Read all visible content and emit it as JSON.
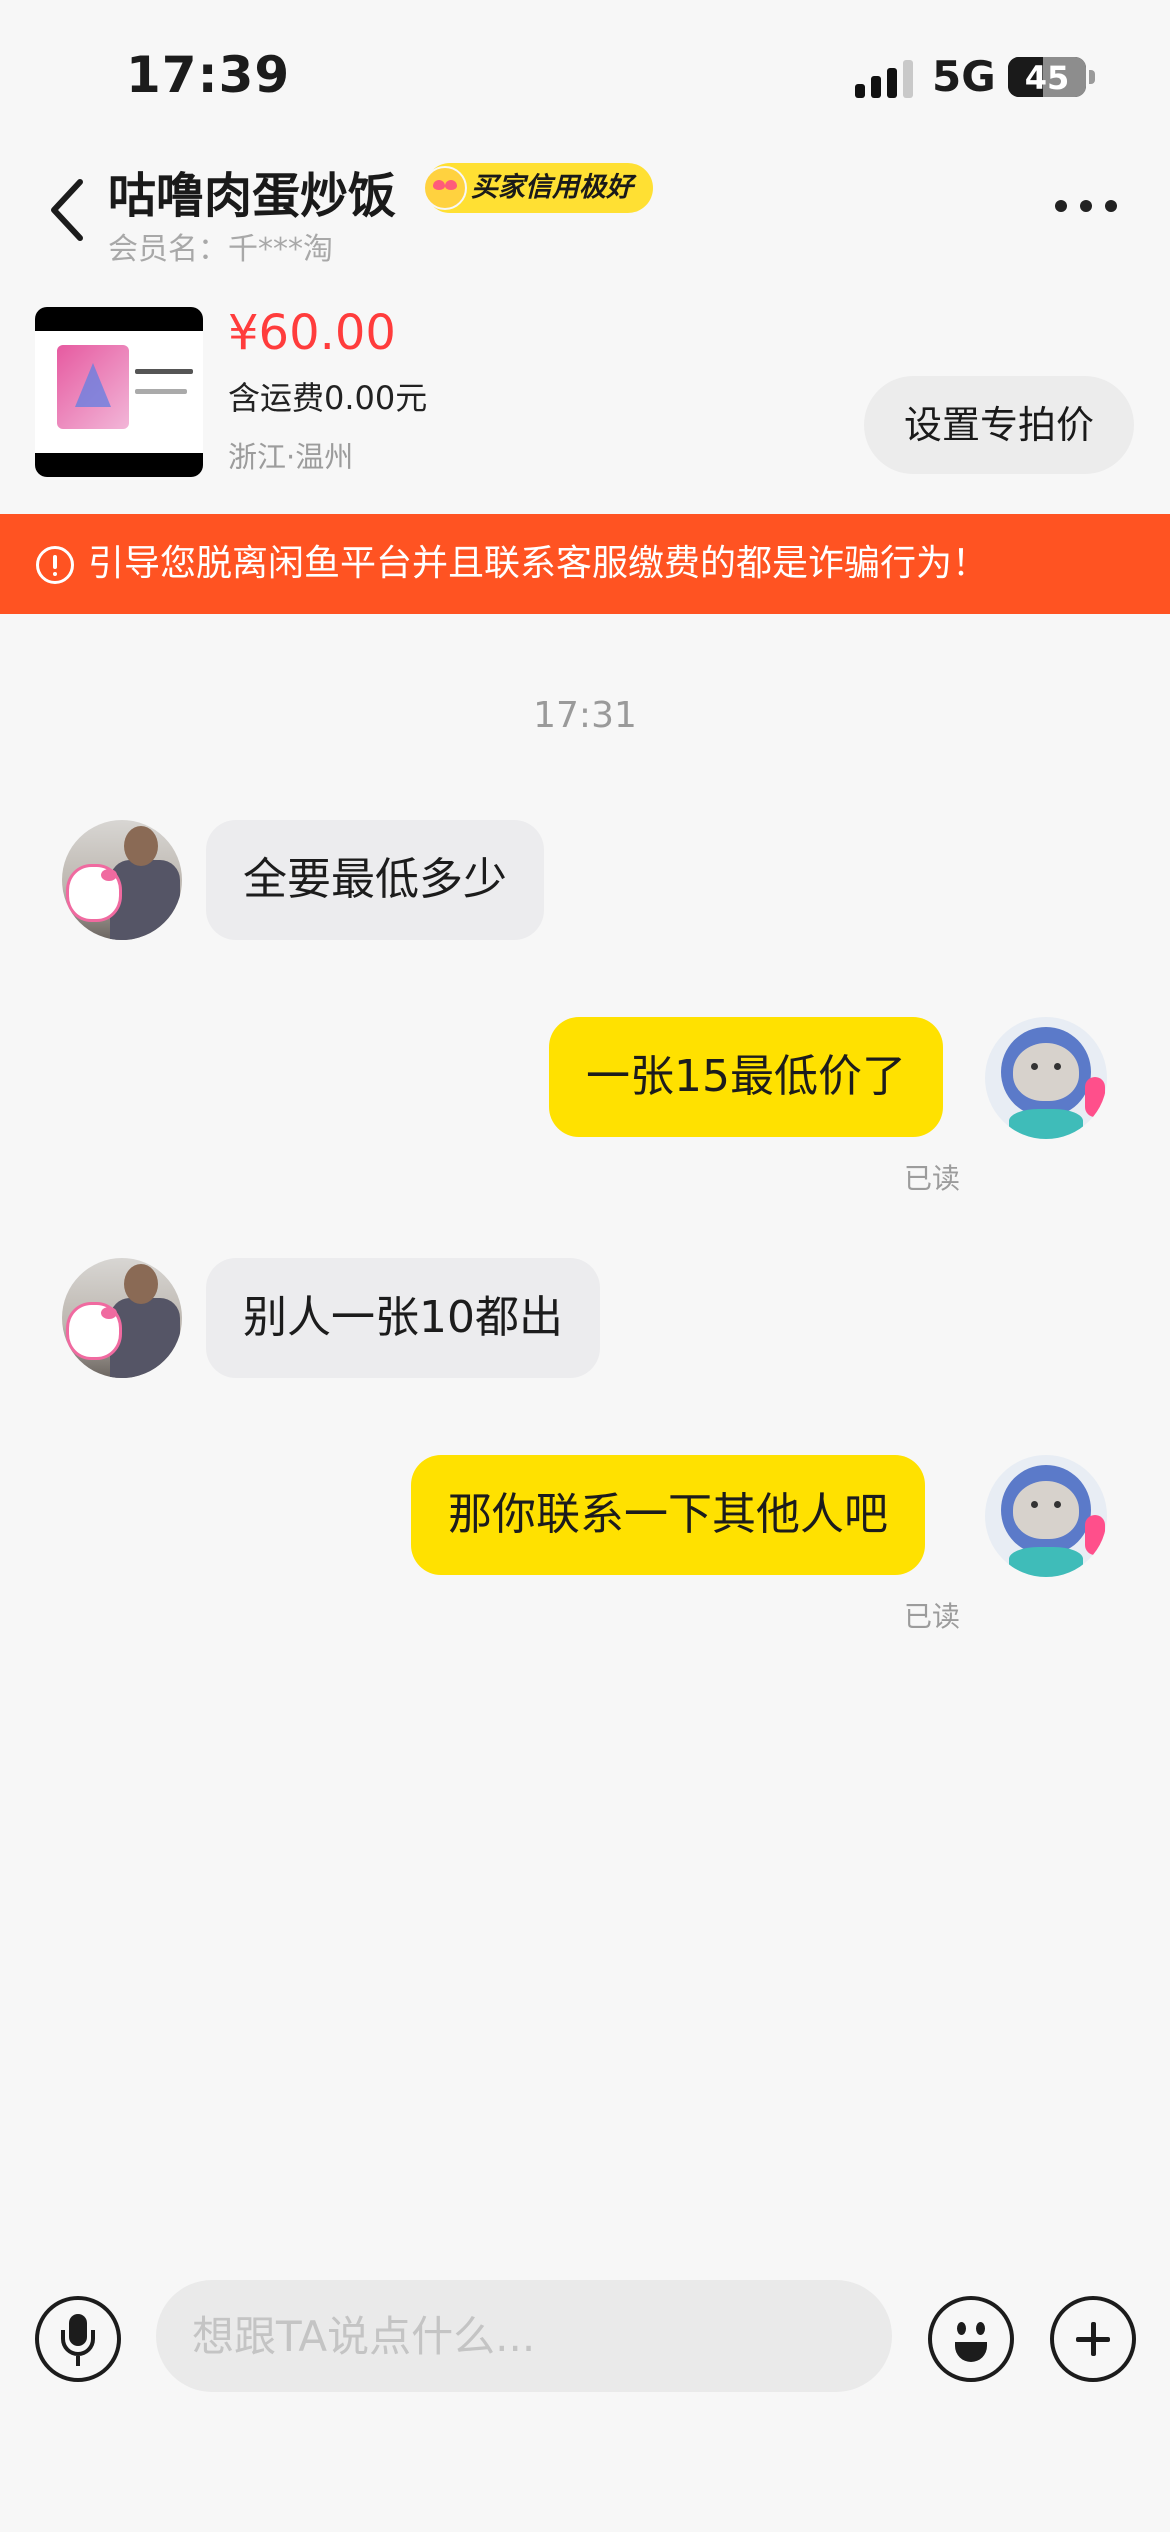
{
  "status_bar": {
    "time": "17:39",
    "network": "5G",
    "battery": "45",
    "battery_level_percent": 45,
    "signal_bars": 3
  },
  "header": {
    "contact_name": "咕噜肉蛋炒饭",
    "credit_badge": "买家信用极好",
    "member_label": "会员名：",
    "member_name": "千***淘"
  },
  "product": {
    "price": "¥60.00",
    "shipping": "含运费0.00元",
    "location": "浙江·温州",
    "special_price_button": "设置专拍价"
  },
  "warning": {
    "text": "引导您脱离闲鱼平台并且联系客服缴费的都是诈骗行为！"
  },
  "chat": {
    "timestamp": "17:31",
    "messages": [
      {
        "side": "in",
        "text": "全要最低多少"
      },
      {
        "side": "out",
        "text": "一张15最低价了",
        "status": "已读"
      },
      {
        "side": "in",
        "text": "别人一张10都出"
      },
      {
        "side": "out",
        "text": "那你联系一下其他人吧",
        "status": "已读"
      }
    ]
  },
  "input": {
    "placeholder": "想跟TA说点什么..."
  },
  "colors": {
    "accent_yellow": "#ffe100",
    "warning_orange": "#ff5322",
    "price_red": "#ff3c3c"
  },
  "icons": [
    "back-icon",
    "more-icon",
    "warning-icon",
    "microphone-icon",
    "emoji-icon",
    "plus-icon"
  ]
}
